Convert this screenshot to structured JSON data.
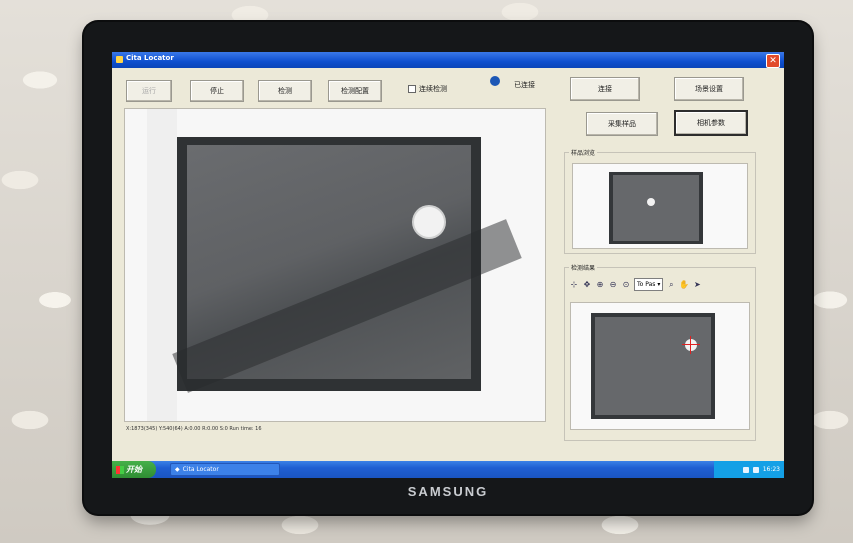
{
  "window": {
    "title": "Cita Locator"
  },
  "toolbar": {
    "btn_run": "运行",
    "btn_stop": "停止",
    "btn_detect": "检测",
    "btn_detect_config": "检测配置",
    "continuous_check_label": "连续检测",
    "connection_status": "已连接"
  },
  "right_panel": {
    "btn_connect": "连接",
    "btn_scene_settings": "场景设置",
    "btn_capture_sample": "采集样品",
    "btn_camera_params": "相机参数",
    "sample_preview_label": "样品浏览",
    "result_label": "检测结果",
    "zoom_select_value": "To Pas"
  },
  "status": {
    "coordinates": "X:1873(345) Y:540(64) A:0.00 R:0.00 S:0 Run time: 16"
  },
  "taskbar": {
    "start_label": "开始",
    "task_item": "Cita Locator",
    "clock": "16:23"
  },
  "monitor": {
    "brand": "SAMSUNG"
  },
  "icons": [
    "app-icon",
    "close-icon",
    "connection-status-icon",
    "select-tool-icon",
    "zoom-in-icon",
    "zoom-out-icon",
    "fit-zoom-icon",
    "hand-icon",
    "pointer-icon"
  ]
}
